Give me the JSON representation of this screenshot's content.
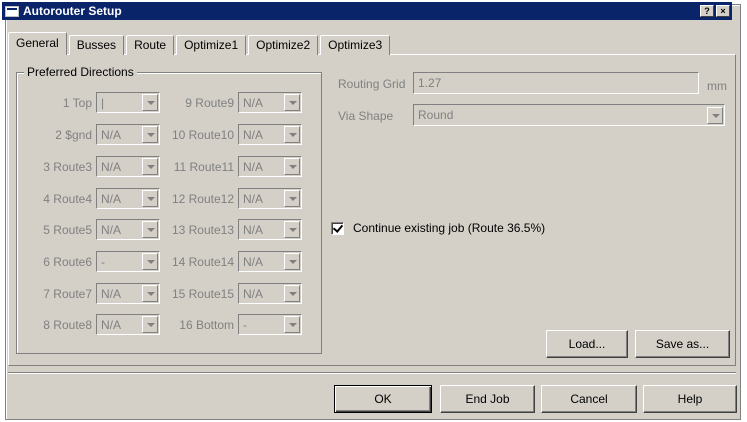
{
  "window": {
    "title": "Autorouter Setup",
    "help_btn": "?",
    "close_btn": "×"
  },
  "tabs": [
    "General",
    "Busses",
    "Route",
    "Optimize1",
    "Optimize2",
    "Optimize3"
  ],
  "preferred_directions": {
    "label": "Preferred Directions",
    "left": [
      {
        "label": "1 Top",
        "value": "|"
      },
      {
        "label": "2 $gnd",
        "value": "N/A"
      },
      {
        "label": "3 Route3",
        "value": "N/A"
      },
      {
        "label": "4 Route4",
        "value": "N/A"
      },
      {
        "label": "5 Route5",
        "value": "N/A"
      },
      {
        "label": "6 Route6",
        "value": "-"
      },
      {
        "label": "7 Route7",
        "value": "N/A"
      },
      {
        "label": "8 Route8",
        "value": "N/A"
      }
    ],
    "right": [
      {
        "label": "9 Route9",
        "value": "N/A"
      },
      {
        "label": "10 Route10",
        "value": "N/A"
      },
      {
        "label": "11 Route11",
        "value": "N/A"
      },
      {
        "label": "12 Route12",
        "value": "N/A"
      },
      {
        "label": "13 Route13",
        "value": "N/A"
      },
      {
        "label": "14 Route14",
        "value": "N/A"
      },
      {
        "label": "15 Route15",
        "value": "N/A"
      },
      {
        "label": "16 Bottom",
        "value": "-"
      }
    ]
  },
  "routing_grid": {
    "label": "Routing Grid",
    "value": "1.27",
    "unit": "mm"
  },
  "via_shape": {
    "label": "Via Shape",
    "value": "Round"
  },
  "continue_job": {
    "label": "Continue existing job (Route 36.5%)",
    "checked": true
  },
  "panel_buttons": {
    "load": "Load...",
    "save_as": "Save as..."
  },
  "footer_buttons": {
    "ok": "OK",
    "end_job": "End Job",
    "cancel": "Cancel",
    "help": "Help"
  }
}
